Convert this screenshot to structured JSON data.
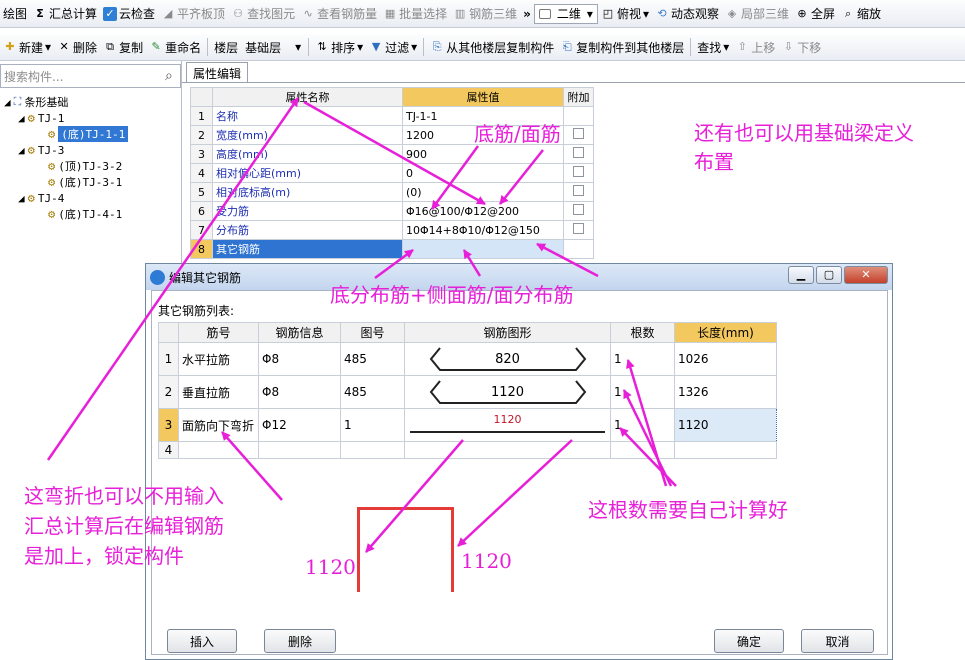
{
  "toolbar1": {
    "draw": "绘图",
    "sum_calc": "汇总计算",
    "cloud_check": "云检查",
    "flat_slab_top": "平齐板顶",
    "find_elem": "查找图元",
    "view_rebar_qty": "查看钢筋量",
    "batch_select": "批量选择",
    "rebar_3d": "钢筋三维",
    "more": "»",
    "view_mode": "二维",
    "top_view": "俯视",
    "dynamic_view": "动态观察",
    "local_3d": "局部三维",
    "full_screen": "全屏",
    "zoom": "缩放"
  },
  "toolbar2": {
    "new": "新建",
    "delete": "删除",
    "copy": "复制",
    "rename": "重命名",
    "floor_label": "楼层",
    "floor_value": "基础层",
    "sort": "排序",
    "filter": "过滤",
    "copy_from_floor": "从其他楼层复制构件",
    "copy_to_floor": "复制构件到其他楼层",
    "find": "查找",
    "move_up": "上移",
    "move_down": "下移"
  },
  "search": {
    "placeholder": "搜索构件..."
  },
  "tree": {
    "root": "条形基础",
    "nodes": [
      "TJ-1",
      "(底)TJ-1-1",
      "TJ-3",
      "(顶)TJ-3-2",
      "(底)TJ-3-1",
      "TJ-4",
      "(底)TJ-4-1"
    ]
  },
  "attr_panel": {
    "tab": "属性编辑",
    "headers": {
      "name": "属性名称",
      "value": "属性值",
      "extra": "附加"
    },
    "rows": [
      {
        "n": "1",
        "name": "名称",
        "value": "TJ-1-1"
      },
      {
        "n": "2",
        "name": "宽度(mm)",
        "value": "1200"
      },
      {
        "n": "3",
        "name": "高度(mm)",
        "value": "900"
      },
      {
        "n": "4",
        "name": "相对偏心距(mm)",
        "value": "0"
      },
      {
        "n": "5",
        "name": "相对底标高(m)",
        "value": "(0)"
      },
      {
        "n": "6",
        "name": "受力筋",
        "value": "Φ16@100/Φ12@200"
      },
      {
        "n": "7",
        "name": "分布筋",
        "value": "10Φ14+8Φ10/Φ12@150"
      },
      {
        "n": "8",
        "name": "其它钢筋",
        "value": ""
      }
    ]
  },
  "dialog": {
    "title": "编辑其它钢筋",
    "list_label": "其它钢筋列表:",
    "headers": {
      "bar_no": "筋号",
      "info": "钢筋信息",
      "fig_no": "图号",
      "figure": "钢筋图形",
      "count": "根数",
      "length": "长度(mm)"
    },
    "rows": [
      {
        "n": "1",
        "bar_no": "水平拉筋",
        "info": "Φ8",
        "fig_no": "485",
        "figure": "820",
        "count": "1",
        "length": "1026"
      },
      {
        "n": "2",
        "bar_no": "垂直拉筋",
        "info": "Φ8",
        "fig_no": "485",
        "figure": "1120",
        "count": "1",
        "length": "1326"
      },
      {
        "n": "3",
        "bar_no": "面筋向下弯折",
        "info": "Φ12",
        "fig_no": "1",
        "figure": "1120",
        "count": "1",
        "length": "1120"
      },
      {
        "n": "4",
        "bar_no": "",
        "info": "",
        "fig_no": "",
        "figure": "",
        "count": "",
        "length": ""
      }
    ],
    "btn_insert": "插入",
    "btn_delete": "删除",
    "btn_ok": "确定",
    "btn_cancel": "取消"
  },
  "annotations": {
    "bottom_top_bars": "底筋/面筋",
    "beam_alternative_1": "还有也可以用基础梁定义",
    "beam_alternative_2": "布置",
    "distribution_bars": "底分布筋+侧面筋/面分布筋",
    "bend_note_1": "这弯折也可以不用输入",
    "bend_note_2": "汇总计算后在编辑钢筋",
    "bend_note_3": "是加上，锁定构件",
    "count_note": "这根数需要自己计算好",
    "dim_left": "1120",
    "dim_right": "1120"
  },
  "colors": {
    "annotation": "#e81fd9",
    "bracket": "#e53b38",
    "header_orange": "#f3c85f",
    "selection": "#2f74d0"
  }
}
